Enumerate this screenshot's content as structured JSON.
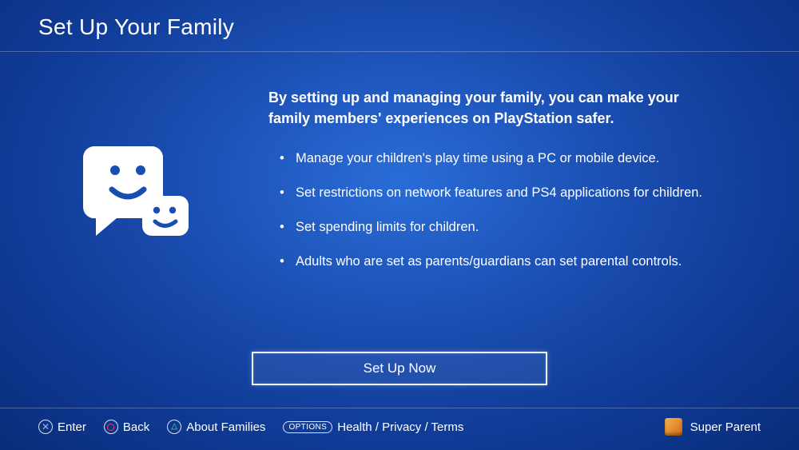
{
  "header": {
    "title": "Set Up Your Family"
  },
  "main": {
    "intro": "By setting up and managing your family, you can make your family members' experiences on PlayStation safer.",
    "bullets": [
      "Manage your children's play time using a PC or mobile device.",
      "Set restrictions on network features and PS4 applications for children.",
      "Set spending limits for children.",
      "Adults who are set as parents/guardians can set parental controls."
    ],
    "cta_label": "Set Up Now"
  },
  "footer": {
    "enter_label": "Enter",
    "back_label": "Back",
    "about_label": "About Families",
    "options_pill": "OPTIONS",
    "legal_label": "Health / Privacy / Terms",
    "user_label": "Super Parent"
  }
}
